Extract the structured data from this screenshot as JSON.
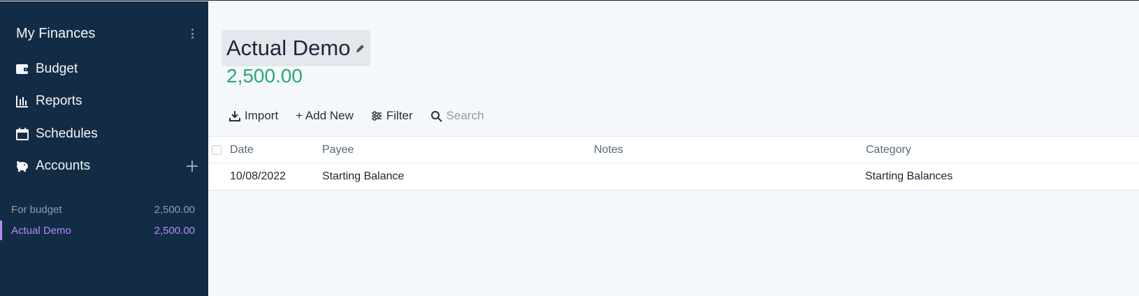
{
  "sidebar": {
    "title": "My Finances",
    "nav": [
      {
        "label": "Budget",
        "icon": "wallet-icon"
      },
      {
        "label": "Reports",
        "icon": "bar-chart-icon"
      },
      {
        "label": "Schedules",
        "icon": "calendar-icon"
      },
      {
        "label": "Accounts",
        "icon": "piggy-bank-icon"
      }
    ],
    "accounts": {
      "for_budget_label": "For budget",
      "for_budget_balance": "2,500.00",
      "items": [
        {
          "name": "Actual Demo",
          "balance": "2,500.00"
        }
      ]
    }
  },
  "account": {
    "title": "Actual Demo",
    "balance": "2,500.00"
  },
  "toolbar": {
    "import_label": "Import",
    "add_new_label": "+ Add New",
    "filter_label": "Filter",
    "search_placeholder": "Search"
  },
  "table": {
    "headers": {
      "date": "Date",
      "payee": "Payee",
      "notes": "Notes",
      "category": "Category"
    },
    "rows": [
      {
        "date": "10/08/2022",
        "payee": "Starting Balance",
        "notes": "",
        "category": "Starting Balances"
      }
    ]
  },
  "colors": {
    "sidebar_bg": "#132c46",
    "active_account": "#b48bf5",
    "positive_balance": "#2aa876"
  }
}
